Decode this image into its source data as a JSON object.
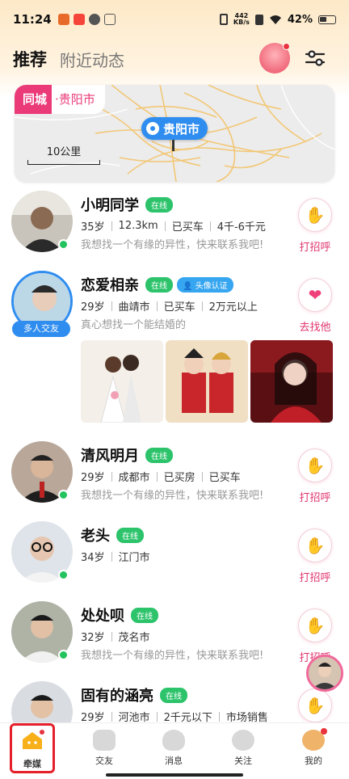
{
  "status_bar": {
    "time": "11:24",
    "net_speed_value": "442",
    "net_speed_unit": "KB/s",
    "battery": "42%"
  },
  "header": {
    "tab_recommend": "推荐",
    "tab_nearby": "附近动态"
  },
  "map": {
    "tag_same_city": "同城",
    "tag_city": "·贵阳市",
    "scale_label": "10公里",
    "pin_label": "贵阳市"
  },
  "users": [
    {
      "name": "小明同学",
      "online_label": "在线",
      "meta": [
        "35岁",
        "12.3km",
        "已买车",
        "4千-6千元"
      ],
      "desc": "我想找一个有缘的异性，快来联系我吧!",
      "action_icon": "wave-hand-icon",
      "action_label": "打招呼"
    },
    {
      "name": "恋爱相亲",
      "online_label": "在线",
      "verify_label": "头像认证",
      "group_label": "多人交友",
      "meta": [
        "29岁",
        "曲靖市",
        "已买车",
        "2万元以上"
      ],
      "desc": "真心想找一个能结婚的",
      "action_icon": "heart-icon",
      "action_label": "去找他"
    },
    {
      "name": "清风明月",
      "online_label": "在线",
      "meta": [
        "29岁",
        "成都市",
        "已买房",
        "已买车"
      ],
      "desc": "我想找一个有缘的异性，快来联系我吧!",
      "action_icon": "wave-hand-icon",
      "action_label": "打招呼"
    },
    {
      "name": "老头",
      "online_label": "在线",
      "meta": [
        "34岁",
        "江门市"
      ],
      "desc": "",
      "action_icon": "wave-hand-icon",
      "action_label": "打招呼"
    },
    {
      "name": "处处呗",
      "online_label": "在线",
      "meta": [
        "32岁",
        "茂名市"
      ],
      "desc": "我想找一个有缘的异性，快来联系我吧!",
      "action_icon": "wave-hand-icon",
      "action_label": "打招呼"
    },
    {
      "name": "固有的涵亮",
      "online_label": "在线",
      "meta": [
        "29岁",
        "河池市",
        "2千元以下",
        "市场销售"
      ],
      "desc": "",
      "action_icon": "wave-hand-icon",
      "action_label": ""
    }
  ],
  "bottom_nav": {
    "items": [
      {
        "label": "牵媒",
        "icon": "home-icon",
        "active": true
      },
      {
        "label": "交友",
        "icon": "video-icon"
      },
      {
        "label": "消息",
        "icon": "heart-chat-icon"
      },
      {
        "label": "关注",
        "icon": "face-icon"
      },
      {
        "label": "我的",
        "icon": "profile-avatar-icon"
      }
    ]
  },
  "colors": {
    "accent_pink": "#ea3b78",
    "online_green": "#2cc36b",
    "verify_blue": "#37a6f0",
    "active_frame_red": "#e5202a"
  }
}
